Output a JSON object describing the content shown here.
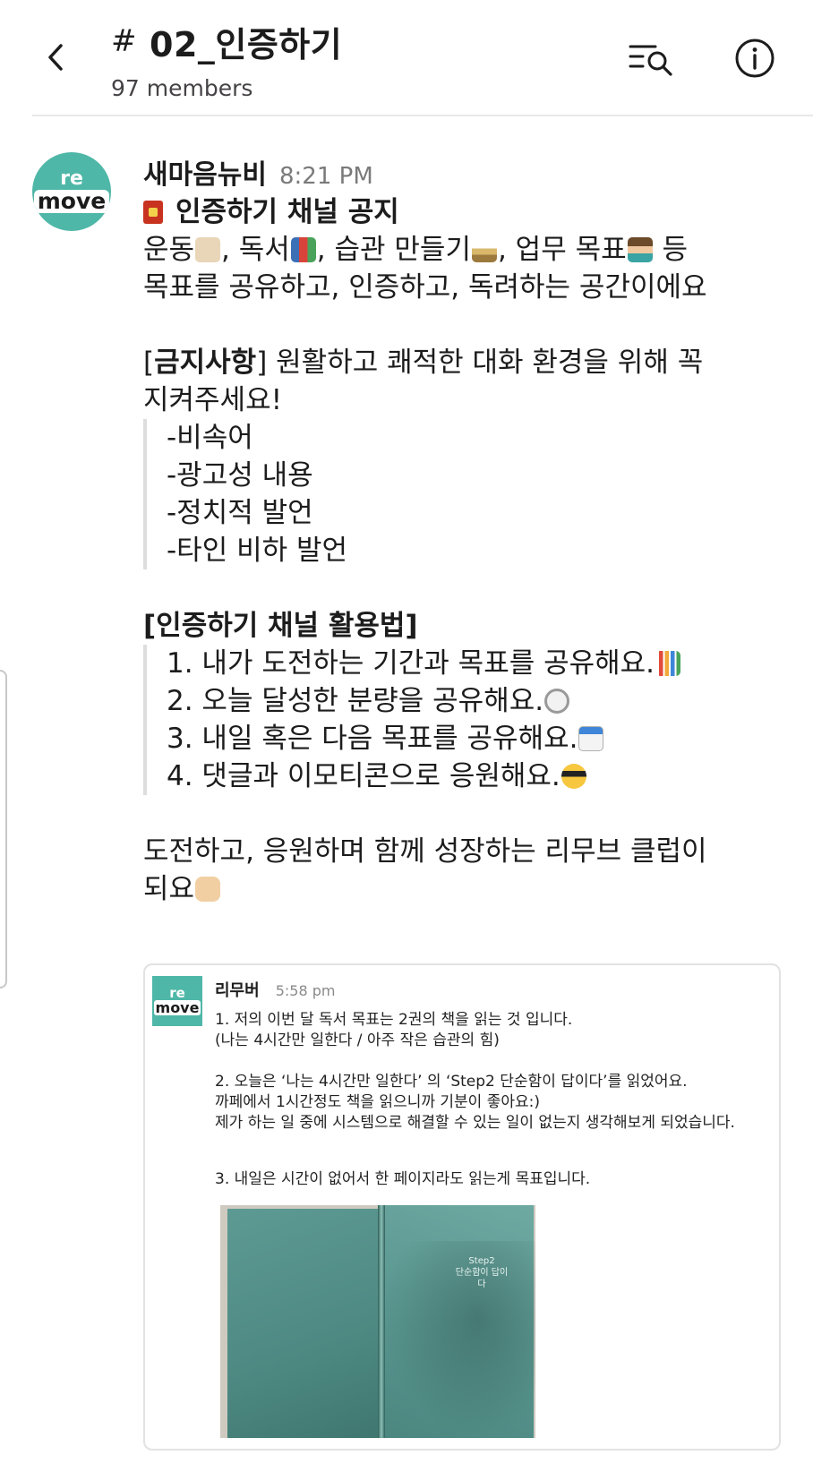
{
  "header": {
    "hash": "#",
    "channel_name": "02_인증하기",
    "members": "97 members",
    "icons": {
      "back": "back-chevron-icon",
      "search": "search-in-channel-icon",
      "info": "info-icon"
    }
  },
  "message": {
    "author": "새마음뉴비",
    "time": "8:21 PM",
    "avatar": {
      "top": "re",
      "bottom": "move"
    },
    "notice_title": "인증하기 채널 공지",
    "intro": {
      "l1_a": "운동",
      "l1_b": ", 독서",
      "l1_c": ", 습관 만들기",
      "l1_d": ", 업무 목표",
      "l1_e": " 등",
      "l2": "목표를 공유하고, 인증하고, 독려하는 공간이에요"
    },
    "rules": {
      "heading_bracket_open": "[",
      "heading": "금지사항",
      "heading_rest": "] 원활하고 쾌적한 대화 환경을 위해 꼭",
      "heading_line2": "지켜주세요!",
      "items": [
        "-비속어",
        "-광고성 내용",
        "-정치적 발언",
        "-타인 비하 발언"
      ]
    },
    "usage": {
      "heading": "[인증하기 채널 활용법]",
      "items": [
        "1. 내가 도전하는 기간과 목표를 공유해요.",
        "2. 오늘 달성한 분량을 공유해요.",
        "3. 내일 혹은 다음 목표를 공유해요.",
        "4. 댓글과 이모티콘으로 응원해요."
      ]
    },
    "closing": {
      "l1": "도전하고, 응원하며 함께 성장하는 리무브 클럽이",
      "l2": "되요"
    }
  },
  "attachment": {
    "author": "리무버",
    "time": "5:58 pm",
    "avatar": {
      "top": "re",
      "bottom": "move"
    },
    "lines": [
      "1. 저의 이번 달 독서 목표는 2권의 책을 읽는 것 입니다.",
      "(나는 4시간만 일한다 / 아주 작은 습관의 힘)",
      "2. 오늘은 ‘나는 4시간만 일한다’ 의 ‘Step2 단순함이 답이다’를 읽었어요.",
      "까페에서 1시간정도 책을 읽으니까 기분이 좋아요:)",
      "제가 하는 일 중에 시스템으로 해결할 수 있는 일이 없는지 생각해보게 되었습니다.",
      "3. 내일은 시간이 없어서 한 페이지라도 읽는게 목표입니다."
    ],
    "photo": {
      "right_page_step": "Step2",
      "right_page_title": "단순함이 답이다"
    }
  }
}
